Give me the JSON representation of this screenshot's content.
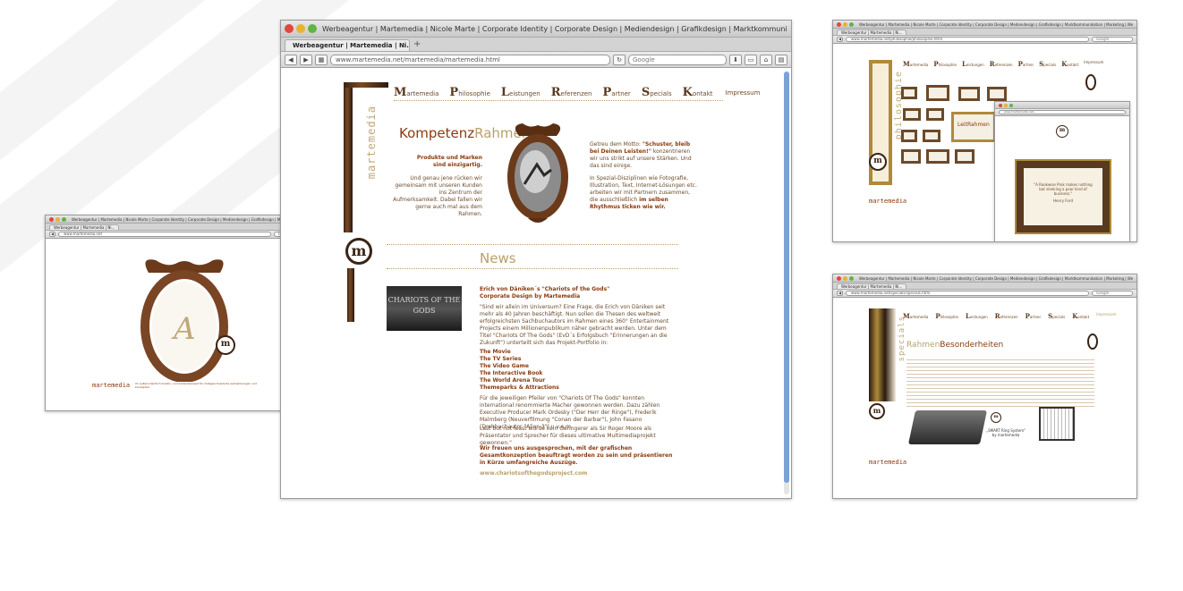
{
  "browser": {
    "window_title": "Werbeagentur | Martemedia | Nicole Marte | Corporate Identity | Corporate Design | Mediendesign | Grafikdesign | Marktkommunikation | Marketing | Werbelösungen | Werb...",
    "tab_label": "Werbeagentur | Martemedia | Ni...",
    "url": "www.martemedia.net/martemedia/martemedia.html",
    "search_placeholder": "Google"
  },
  "nav": {
    "items": [
      {
        "cap": "M",
        "rest": "artemedia"
      },
      {
        "cap": "P",
        "rest": "hilosophie"
      },
      {
        "cap": "L",
        "rest": "eistungen"
      },
      {
        "cap": "R",
        "rest": "eferenzen"
      },
      {
        "cap": "P",
        "rest": "artner"
      },
      {
        "cap": "S",
        "rest": "pecials"
      },
      {
        "cap": "K",
        "rest": "ontakt"
      }
    ],
    "impressum": "Impressum"
  },
  "brand": {
    "logo_text": "martemedia",
    "logo_initial": "m"
  },
  "main": {
    "heading_part1": "Kompetenz",
    "heading_part2": "Rahmen",
    "intro_bold": "Produkte und Marken sind einzigartig.",
    "intro_text": "Und genau jene rücken wir gemeinsam mit unseren Kunden ins Zentrum der Aufmerksamkeit. Dabei fallen wir gerne auch mal aus dem Rahmen.",
    "right_text_1a": "Getreu dem Motto: ",
    "right_text_1b": "\"Schuster, bleib bei Deinen Leisten!\"",
    "right_text_1c": " konzentrieren wir uns strikt auf unsere Stärken. Und das sind einige.",
    "right_text_2a": "In Spezial-Disziplinen wie Fotografie, Illustration, Text, Internet-Lösungen etc. arbeiten wir mit Partnern zusammen, die ausschließlich ",
    "right_text_2b": "im selben Rhythmus ticken wie wir.",
    "news_heading": "News",
    "news_image_text": "CHARIOTS OF THE GODS",
    "news_title": "Erich von Däniken´s \"Chariots of the Gods\"",
    "news_subtitle": "Corporate Design by Martemedia",
    "news_para1": "\"Sind wir allein im Universum? Eine Frage, die Erich von Däniken seit mehr als 40 Jahren beschäftigt. Nun sollen die Thesen des weltweit erfolgreichsten Sachbuchautors im Rahmen eines 360° Entertainment Projects einem Millionenpublikum näher gebracht werden. Unter dem Titel \"Chariots Of The Gods\" (EvD´s Erfolgsbuch \"Erinnerungen an die Zukunft\") unterteilt sich das Projekt-Portfolio in:",
    "news_list": [
      "The Movie",
      "The TV Series",
      "The Video Game",
      "The Interactive Book",
      "The World Arena Tour",
      "Themeparks & Attractions"
    ],
    "news_para2": "Für die jeweiligen Pfeiler von \"Chariots Of The Gods\" konnten international renommierte Macher gewonnen werden. Dazu zählen Executive Producer Mark Ordesky (\"Der Herr der Ringe\"), Frederik Malmberg (Neuverfilmung \"Conan der Barbar\"), John Fasano (Drehbuchautor \"Alien 3\") u.v.a.m.",
    "news_para3": "Last but not least wurde kein Geringerer als Sir Roger Moore als Präsentator und Sprecher für dieses ultimative Multimediaprojekt gewonnen.\"",
    "news_para4": "Wir freuen uns ausgesprochen, mit der grafischen Gesamtkonzeption beauftragt worden zu sein und präsentieren in Kürze umfangreiche Auszüge.",
    "news_link": "www.chariotsofthegodsproject.com"
  },
  "small_left": {
    "url": "www.martemedia.net",
    "footer_text": "Ihr außerordentlich kreativ- und kostenbewusst für maßgeschneiderte werbelösungen und konzeption"
  },
  "small_top_right": {
    "url": "www.martemedia.net/philosophie/philosophie.html",
    "popup_url": "www.martemedia.net/...",
    "side_label": "philosophie",
    "heading": "LeitRahmen",
    "quote": "\"A Rookwise Prok makes nothing but sleeking a poor kind of business.\"",
    "quote_author": "Henry Ford"
  },
  "small_bottom_right": {
    "url": "www.martemedia.net/specials/specials.html",
    "side_label": "specials",
    "heading_part1": "Rahmen",
    "heading_part2": "Besonderheiten",
    "product_label": "„SMART Ring System\" by martemedia"
  }
}
